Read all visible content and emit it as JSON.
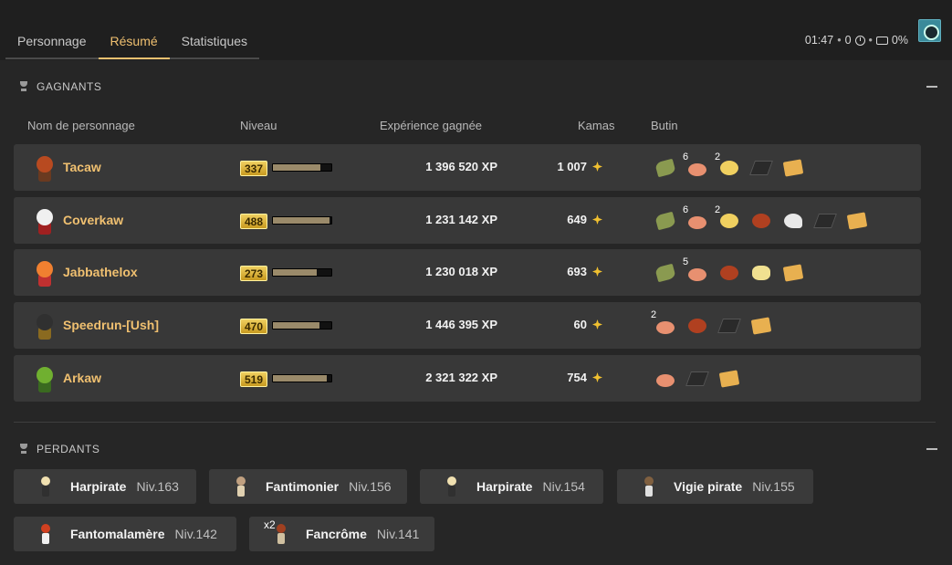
{
  "tabs": [
    {
      "label": "Personnage",
      "active": false
    },
    {
      "label": "Résumé",
      "active": true
    },
    {
      "label": "Statistiques",
      "active": false
    }
  ],
  "status": {
    "time": "01:47",
    "turns": "0",
    "drop_bonus": "0%"
  },
  "winners": {
    "title": "GAGNANTS",
    "columns": {
      "name": "Nom de personnage",
      "level": "Niveau",
      "xp": "Expérience gagnée",
      "kamas": "Kamas",
      "loot": "Butin"
    },
    "rows": [
      {
        "name": "Tacaw",
        "level": "337",
        "level_progress": 0.82,
        "xp": "1 396 520 XP",
        "kamas": "1 007",
        "head": "#b84a20",
        "body": "#6a3a20",
        "loot": [
          {
            "icon": "leaf-resource-icon",
            "qty": ""
          },
          {
            "icon": "copper-coin-icon",
            "qty": "6"
          },
          {
            "icon": "moon-stone-icon",
            "qty": "2"
          },
          {
            "icon": "dark-plank-icon",
            "qty": ""
          },
          {
            "icon": "treasure-map-icon",
            "qty": ""
          }
        ]
      },
      {
        "name": "Coverkaw",
        "level": "488",
        "level_progress": 0.97,
        "xp": "1 231 142 XP",
        "kamas": "649",
        "head": "#f0f0f0",
        "body": "#a02020",
        "loot": [
          {
            "icon": "leaf-resource-icon",
            "qty": ""
          },
          {
            "icon": "copper-coin-icon",
            "qty": "6"
          },
          {
            "icon": "moon-stone-icon",
            "qty": "2"
          },
          {
            "icon": "fire-orb-icon",
            "qty": ""
          },
          {
            "icon": "cloud-feather-icon",
            "qty": ""
          },
          {
            "icon": "dark-plank-icon",
            "qty": ""
          },
          {
            "icon": "treasure-map-icon",
            "qty": ""
          }
        ]
      },
      {
        "name": "Jabbathelox",
        "level": "273",
        "level_progress": 0.75,
        "xp": "1 230 018 XP",
        "kamas": "693",
        "head": "#f08030",
        "body": "#c03030",
        "loot": [
          {
            "icon": "leaf-resource-icon",
            "qty": ""
          },
          {
            "icon": "copper-coin-icon",
            "qty": "5"
          },
          {
            "icon": "fire-orb-icon",
            "qty": ""
          },
          {
            "icon": "cheese-icon",
            "qty": ""
          },
          {
            "icon": "treasure-map-icon",
            "qty": ""
          }
        ]
      },
      {
        "name": "Speedrun-[Ush]",
        "level": "470",
        "level_progress": 0.8,
        "xp": "1 446 395 XP",
        "kamas": "60",
        "head": "#303030",
        "body": "#8a6a20",
        "loot": [
          {
            "icon": "copper-coin-icon",
            "qty": "2"
          },
          {
            "icon": "fire-orb-icon",
            "qty": ""
          },
          {
            "icon": "dark-plank-icon",
            "qty": ""
          },
          {
            "icon": "treasure-map-icon",
            "qty": ""
          }
        ]
      },
      {
        "name": "Arkaw",
        "level": "519",
        "level_progress": 0.92,
        "xp": "2 321 322 XP",
        "kamas": "754",
        "head": "#70b030",
        "body": "#3a6a20",
        "loot": [
          {
            "icon": "copper-coin-icon",
            "qty": ""
          },
          {
            "icon": "dark-plank-icon",
            "qty": ""
          },
          {
            "icon": "treasure-map-icon",
            "qty": ""
          }
        ]
      }
    ]
  },
  "losers": {
    "title": "PERDANTS",
    "entries": [
      {
        "name": "Harpirate",
        "level": "Niv.163",
        "count": "",
        "head": "#f0e0b0",
        "body": "#303030"
      },
      {
        "name": "Fantimonier",
        "level": "Niv.156",
        "count": "",
        "head": "#c0a080",
        "body": "#e0d0b0"
      },
      {
        "name": "Harpirate",
        "level": "Niv.154",
        "count": "",
        "head": "#f0e0b0",
        "body": "#303030"
      },
      {
        "name": "Vigie pirate",
        "level": "Niv.155",
        "count": "",
        "head": "#806040",
        "body": "#e0e0e0"
      },
      {
        "name": "Fantomalamère",
        "level": "Niv.142",
        "count": "",
        "head": "#d04020",
        "body": "#f0f0f0"
      },
      {
        "name": "Fancrôme",
        "level": "Niv.141",
        "count": "x2",
        "head": "#a04020",
        "body": "#d0c0a0"
      }
    ]
  }
}
